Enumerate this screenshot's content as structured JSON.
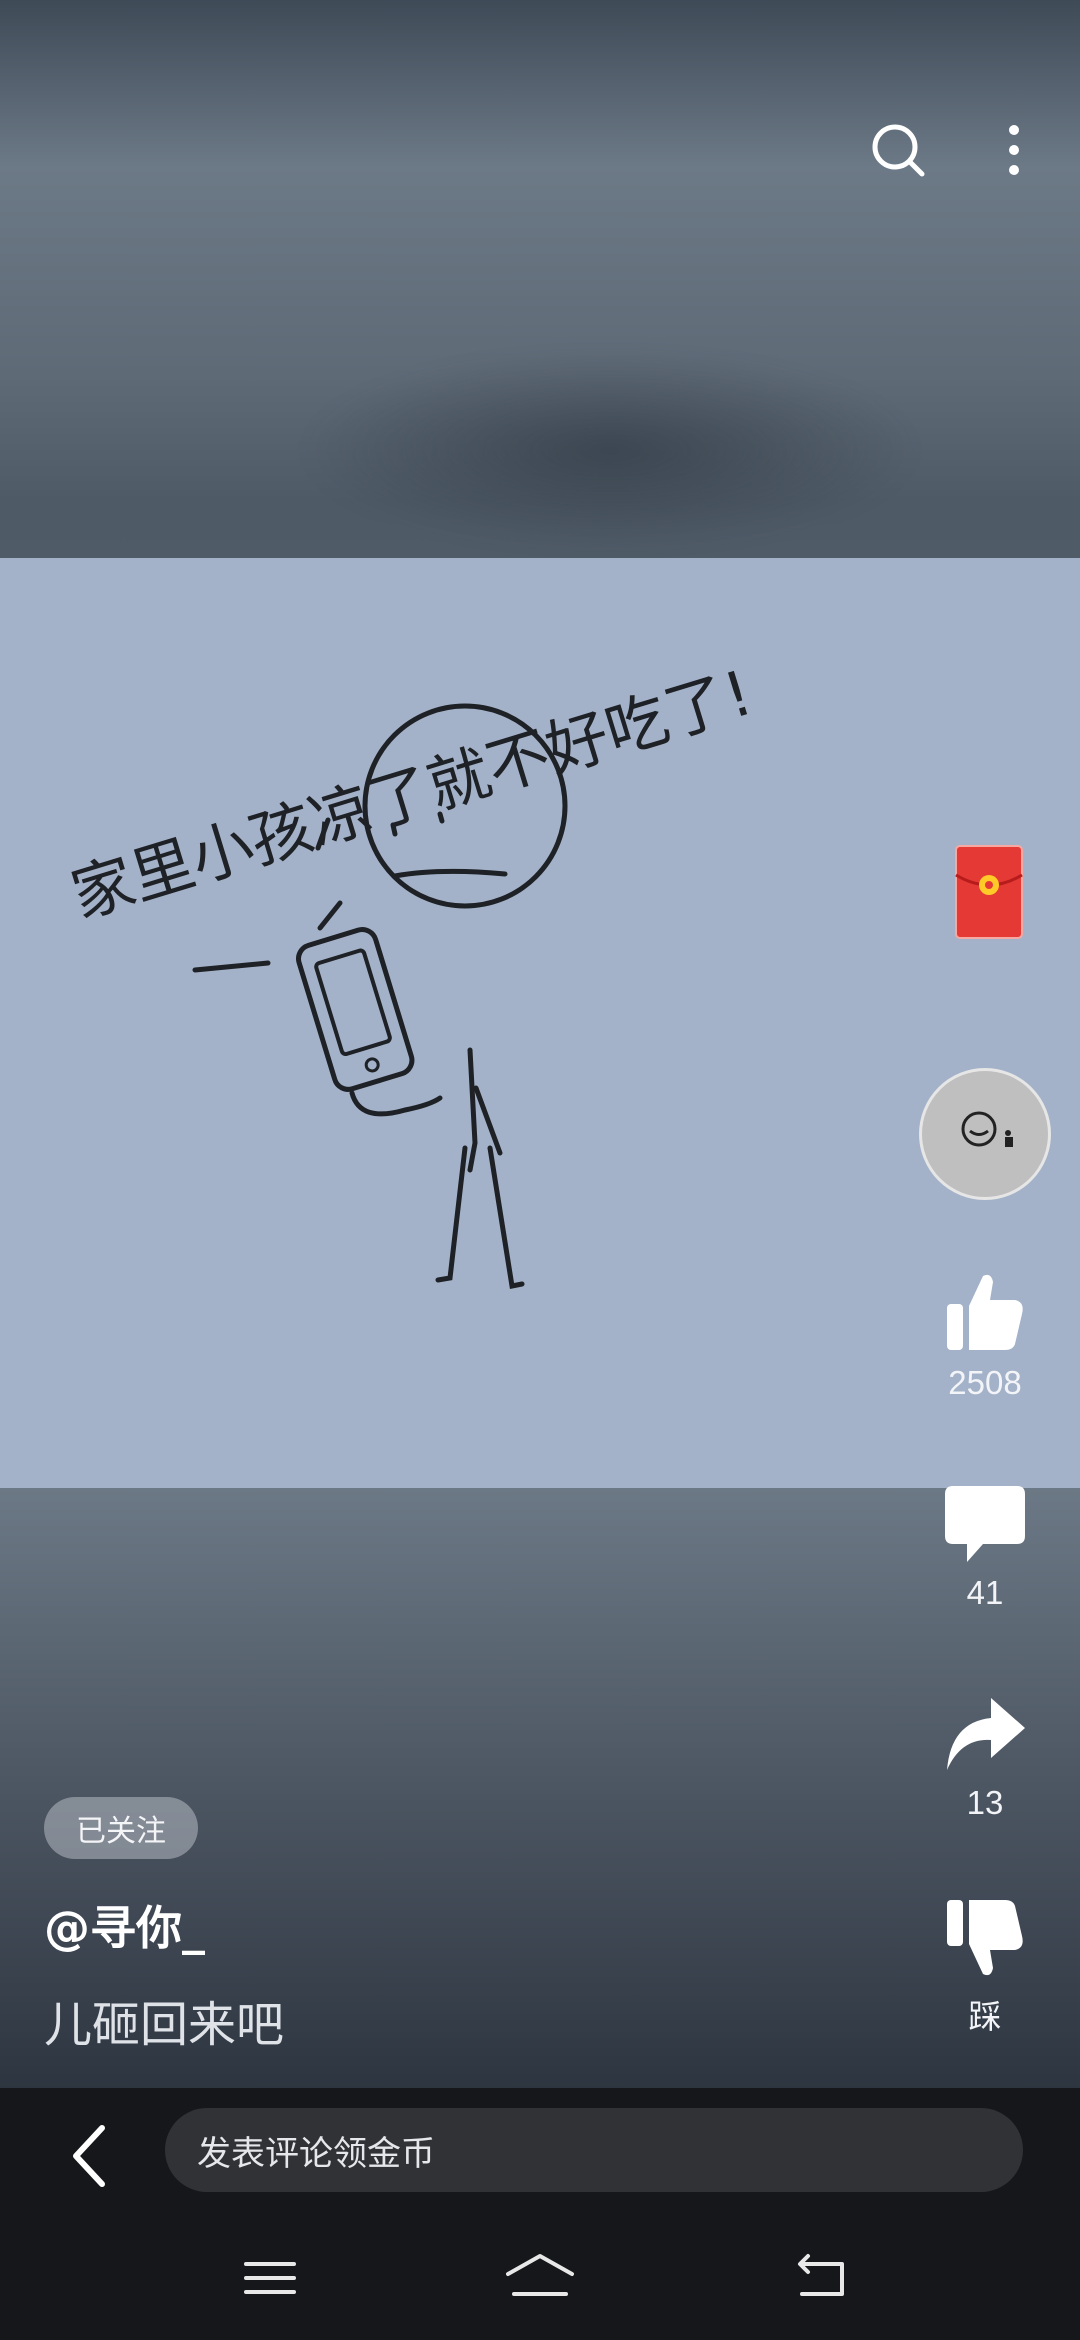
{
  "video": {
    "drawing_text": "家里小孩凉了就不好吃了!"
  },
  "top_bar": {
    "search_icon": "search-icon",
    "more_icon": "more-vertical-icon"
  },
  "actions": {
    "red_packet_icon": "red-packet-icon",
    "avatar_icon": "creator-avatar",
    "like_count": "2508",
    "comment_count": "41",
    "share_count": "13",
    "dislike_label": "踩"
  },
  "post": {
    "follow_status": "已关注",
    "author": "@寻你_",
    "caption": "儿砸回来吧"
  },
  "comment_bar": {
    "placeholder": "发表评论领金币"
  },
  "system_nav": {
    "menu_icon": "menu-icon",
    "home_icon": "home-icon",
    "back_icon": "back-icon"
  },
  "colors": {
    "red_packet": "#e53935",
    "bar_bg": "#15171a"
  }
}
